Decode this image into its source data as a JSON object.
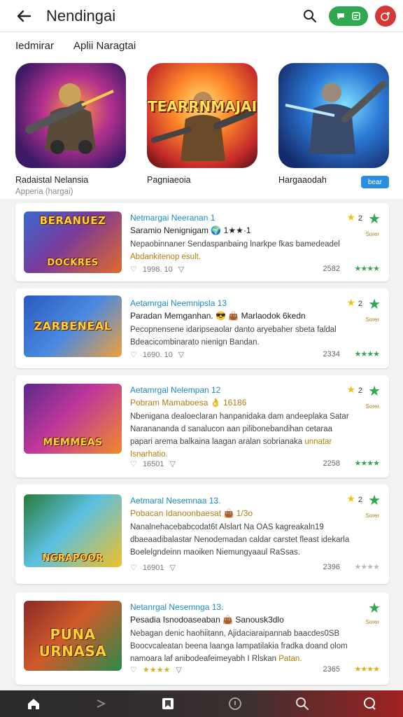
{
  "header": {
    "title": "Nendingai",
    "icons": [
      "back-arrow-icon",
      "search-icon",
      "chat-icon",
      "cart-icon",
      "notification-icon"
    ]
  },
  "tabs": [
    "Iedmirar",
    "Aplii Naragtai"
  ],
  "featured": [
    {
      "name": "Radaistal Nelansia",
      "sub": "Apperia (hargai)",
      "art_text": ""
    },
    {
      "name": "Pagniaeoia",
      "sub": "",
      "art_text": "TEARRNMAJAI"
    },
    {
      "name": "Hargaaodah",
      "sub": "",
      "art_text": ""
    }
  ],
  "featured_badge": "bear",
  "cards": [
    {
      "art_text_top": "BERANUEZ",
      "art_text_bottom": "DOCKRES",
      "title": "Netmargai Neeranan 1",
      "subtitle": "Saramio Nenignigam  🌍 1★★·1",
      "desc": "Nepaobinnaner Sendaspanbaing lnarkpe fkas bamedeadel",
      "desc_gold": "Abdankitenop esult.",
      "likes": "1998. 10",
      "count": "2582",
      "stars": "★★★★",
      "num": "2",
      "small": "Sorer"
    },
    {
      "art_text_top": "ZARBENEAL",
      "art_text_bottom": "",
      "title": "Aetamrgai Neemnipsla 13",
      "subtitle": "Paradan Memganhan. 😎 👜 Marlaodok 6kedn",
      "desc": "Pecopnensene idaripseaolar danto aryebaher sbeta faldal",
      "desc_gold": "Bdeacicombinarato nienign Bandan.",
      "likes": "1690. 10",
      "count": "2334",
      "stars": "★★★★",
      "num": "2",
      "small": "Sorer"
    },
    {
      "art_text_top": "",
      "art_text_bottom": "MEMMEAS",
      "title": "Aetamrgal Nelempan 12",
      "subtitle": "Pobram Mamaboesa 👌 16186",
      "desc": "Nbenigana dealoeclaran hanpanidaka dam andeeplaka Satar Naranananda d sanalucon aan pilibonebandihan cetaraa papari arema balkaina laagan aralan sobrianaka",
      "desc_gold": "unnatar Isnarhatio.",
      "likes": "16501",
      "count": "2258",
      "stars": "★★★★",
      "num": "2",
      "small": "Sorer"
    },
    {
      "art_text_top": "",
      "art_text_bottom": "NGRAPOOR",
      "title": "Aetmaral Nesemnaa 13.",
      "subtitle": "Pobacan Idanoonbaesat 👜 1/3o",
      "desc": "Nanalnehacebabcodat6t Alslart Na OAS kagreakaln19 dbaeaadibalastar Nenodemadan caldar carstet fleast idekarla Boelelgndeinn maoiken Niemungyaaul RaSsas.",
      "desc_gold": "",
      "likes": "16901",
      "count": "2396",
      "stars": "★★★★",
      "num": "2",
      "small": "Sorer"
    },
    {
      "art_text_top": "PUNA",
      "art_text_bottom": "URNASA",
      "title": "Netanrgal Nesemnga 13.",
      "subtitle": "Pesadia Isnodoaseaban 👜 Sanousk3dlo",
      "desc": "Nebagan denic haohiitann, Ajidaciaraipannab baacdes0SB Boocvcaleatan beena laanga lampatilakia fradka doand olom",
      "desc_gold": "Patan.",
      "desc_tail": "namoara laf anibodeafeimeyabh I Rlskan",
      "likes": "★★★★",
      "count": "2365",
      "stars": "★★★★",
      "num": "",
      "small": "Sorer"
    }
  ],
  "bottom_nav": [
    "home-icon",
    "forward-icon",
    "library-icon",
    "info-icon",
    "search-icon",
    "chat-icon"
  ],
  "colors": {
    "accent_blue": "#1a8ac8",
    "green": "#2fa84f",
    "red": "#d63838",
    "gold": "#b07e10"
  }
}
